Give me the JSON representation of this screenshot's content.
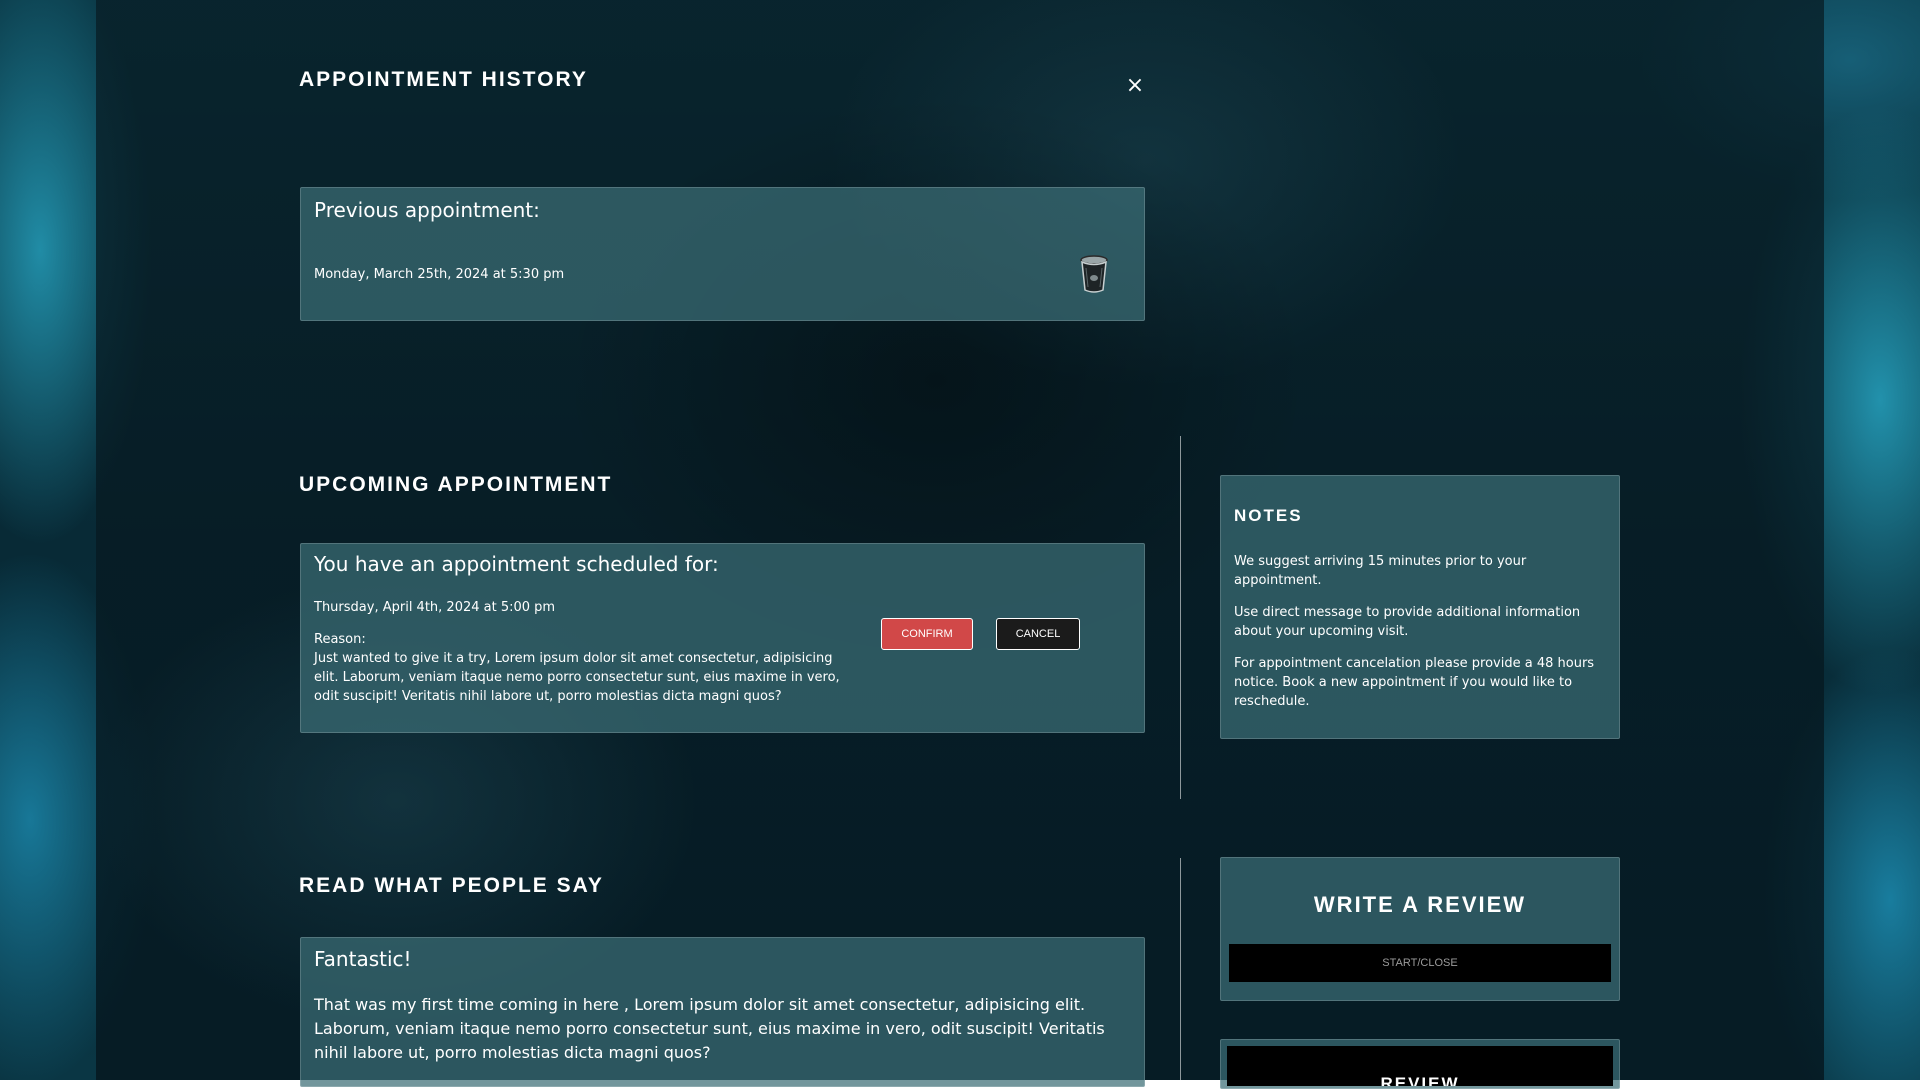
{
  "modal": {
    "title": "APPOINTMENT HISTORY",
    "close_icon": "×"
  },
  "previous": {
    "heading": "Previous appointment:",
    "date": "Monday, March 25th, 2024 at 5:30 pm",
    "delete_icon": "trash-icon"
  },
  "upcoming": {
    "section_title": "UPCOMING APPOINTMENT",
    "heading": "You have an appointment scheduled for:",
    "date": "Thursday, April 4th, 2024 at 5:00 pm",
    "reason_label": "Reason:",
    "reason_text": "Just wanted to give it a try, Lorem ipsum dolor sit amet consectetur, adipisicing elit. Laborum, veniam itaque nemo porro consectetur sunt, eius maxime in vero, odit suscipit! Veritatis nihil labore ut, porro molestias dicta magni quos?",
    "confirm_label": "CONFIRM",
    "cancel_label": "CANCEL",
    "confirm_color": "#d14848"
  },
  "notes": {
    "title": "NOTES",
    "items": [
      "We suggest arriving 15 minutes prior to your appointment.",
      "Use direct message to provide additional information about your upcoming visit.",
      "For appointment cancelation please provide a 48 hours notice. Book a new appointment if you would like to reschedule."
    ]
  },
  "reviews": {
    "section_title": "READ WHAT PEOPLE SAY",
    "items": [
      {
        "heading": "Fantastic!",
        "text": "That was my first time coming in here , Lorem ipsum dolor sit amet consectetur, adipisicing elit. Laborum, veniam itaque nemo porro consectetur sunt, eius maxime in vero, odit suscipit! Veritatis nihil labore ut, porro molestias dicta magni quos?"
      }
    ]
  },
  "write_review": {
    "title": "WRITE A REVIEW",
    "toggle_label": "START/CLOSE",
    "review_label": "REVIEW"
  }
}
